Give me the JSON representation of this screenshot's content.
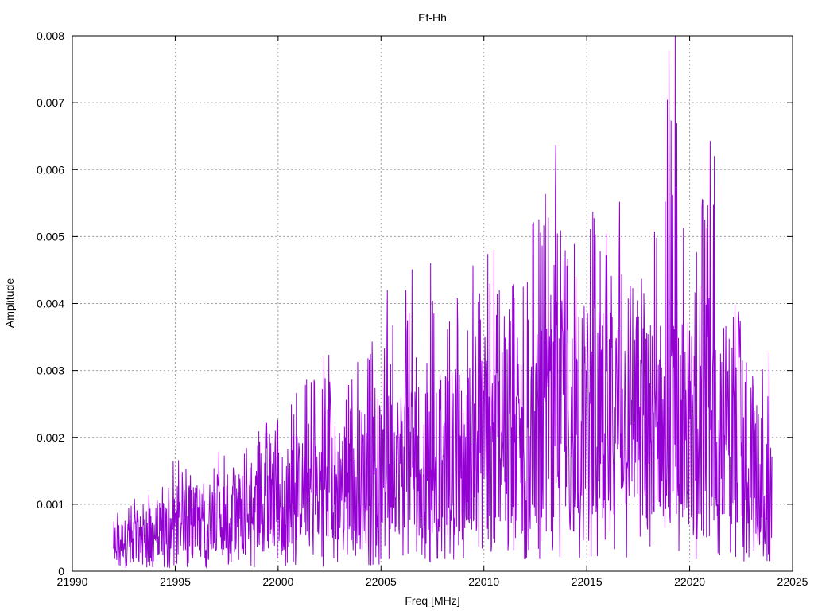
{
  "chart_data": {
    "type": "line",
    "title": "Ef-Hh",
    "xlabel": "Freq [MHz]",
    "ylabel": "Amplitude",
    "xlim": [
      21990,
      22025
    ],
    "ylim": [
      0,
      0.008
    ],
    "xticks": [
      21990,
      21995,
      22000,
      22005,
      22010,
      22015,
      22020,
      22025
    ],
    "xtick_labels": [
      "21990",
      "21995",
      "22000",
      "22005",
      "22010",
      "22015",
      "22020",
      "22025"
    ],
    "yticks": [
      0,
      0.001,
      0.002,
      0.003,
      0.004,
      0.005,
      0.006,
      0.007,
      0.008
    ],
    "ytick_labels": [
      "0",
      "0.001",
      "0.002",
      "0.003",
      "0.004",
      "0.005",
      "0.006",
      "0.007",
      "0.008"
    ],
    "grid": true,
    "line_color": "#9400d3",
    "series": [
      {
        "x_range": [
          21992.0,
          22024.0
        ],
        "envelope": {
          "x": [
            21992,
            21993,
            21994,
            21995,
            21996,
            21997,
            21998,
            21999,
            22000,
            22001,
            22002,
            22003,
            22004,
            22005,
            22006,
            22007,
            22008,
            22009,
            22010,
            22011,
            22012,
            22013,
            22014,
            22015,
            22016,
            22017,
            22018,
            22019,
            22020,
            22021,
            22022,
            22023,
            22024
          ],
          "mean": [
            0.00045,
            0.0005,
            0.0006,
            0.0007,
            0.0008,
            0.00085,
            0.0009,
            0.001,
            0.0011,
            0.0012,
            0.0013,
            0.0014,
            0.0015,
            0.0016,
            0.0017,
            0.0018,
            0.0018,
            0.0019,
            0.002,
            0.002,
            0.0021,
            0.0022,
            0.0023,
            0.0024,
            0.0024,
            0.0024,
            0.0023,
            0.0023,
            0.0023,
            0.0025,
            0.0022,
            0.0018,
            0.0012
          ],
          "max": [
            0.001,
            0.0011,
            0.0012,
            0.0017,
            0.0015,
            0.0019,
            0.0019,
            0.0022,
            0.0024,
            0.0028,
            0.0034,
            0.0032,
            0.0032,
            0.0037,
            0.0045,
            0.0046,
            0.0038,
            0.0044,
            0.0048,
            0.0042,
            0.0048,
            0.0064,
            0.0049,
            0.0054,
            0.0055,
            0.0044,
            0.0045,
            0.008,
            0.0054,
            0.0064,
            0.0042,
            0.0035,
            0.0033
          ]
        },
        "peaks": [
          {
            "x": 22013.5,
            "y": 0.00637
          },
          {
            "x": 22019.3,
            "y": 0.008
          },
          {
            "x": 22021.0,
            "y": 0.00643
          },
          {
            "x": 22021.2,
            "y": 0.0062
          },
          {
            "x": 22016.6,
            "y": 0.00552
          },
          {
            "x": 22015.3,
            "y": 0.00537
          },
          {
            "x": 22020.6,
            "y": 0.00543
          },
          {
            "x": 22010.5,
            "y": 0.0048
          },
          {
            "x": 22010.2,
            "y": 0.00474
          },
          {
            "x": 22014.4,
            "y": 0.00489
          },
          {
            "x": 22007.4,
            "y": 0.0046
          },
          {
            "x": 22006.5,
            "y": 0.00451
          },
          {
            "x": 22005.3,
            "y": 0.0042
          },
          {
            "x": 22006.2,
            "y": 0.0042
          }
        ]
      }
    ]
  }
}
